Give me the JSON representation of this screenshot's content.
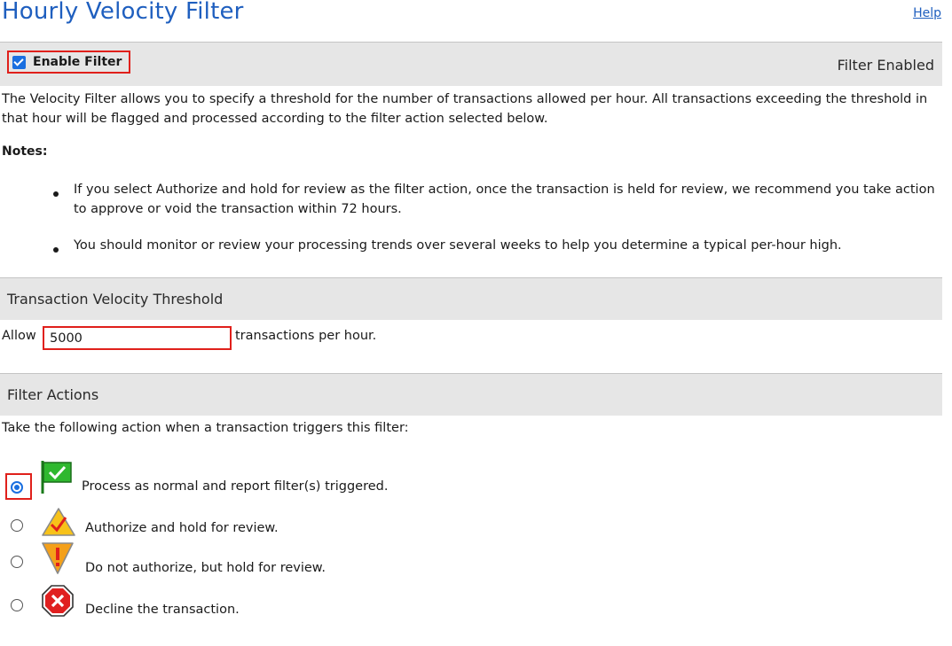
{
  "header": {
    "title": "Hourly Velocity Filter",
    "help_label": "Help"
  },
  "filter_toggle": {
    "label": "Enable Filter",
    "checked": true,
    "status": "Filter Enabled"
  },
  "description": "The Velocity Filter allows you to specify a threshold for the number of transactions allowed per hour. All transactions exceeding the threshold in that hour will be flagged and processed according to the filter action selected below.",
  "notes": {
    "heading": "Notes:",
    "items": [
      "If you select Authorize and hold for review as the filter action, once the transaction is held for review, we recommend you take action to approve or void the transaction within 72 hours.",
      "You should monitor or review your processing trends over several weeks to help you determine a typical per-hour high."
    ]
  },
  "threshold": {
    "section_title": "Transaction Velocity Threshold",
    "prefix": "Allow",
    "value": "5000",
    "suffix": "transactions per hour."
  },
  "actions": {
    "section_title": "Filter Actions",
    "intro": "Take the following action when a transaction triggers this filter:",
    "options": [
      {
        "label": "Process as normal and report filter(s) triggered.",
        "icon": "green-check-flag-icon",
        "selected": true
      },
      {
        "label": "Authorize and hold for review.",
        "icon": "yellow-warning-check-icon",
        "selected": false
      },
      {
        "label": "Do not authorize, but hold for review.",
        "icon": "orange-exclamation-shield-icon",
        "selected": false
      },
      {
        "label": "Decline the transaction.",
        "icon": "red-x-octagon-icon",
        "selected": false
      }
    ]
  },
  "colors": {
    "link": "#1f5fbf",
    "highlight": "#e0201b",
    "section_band": "#e6e6e6",
    "radio_selected": "#1a6fe0"
  }
}
